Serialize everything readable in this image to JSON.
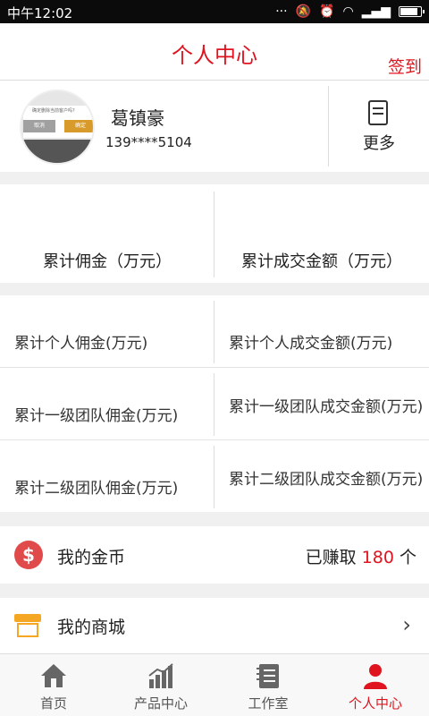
{
  "status_bar": {
    "time": "中午12:02"
  },
  "header": {
    "title": "个人中心",
    "sign_in": "签到"
  },
  "profile": {
    "name": "葛镇豪",
    "phone": "139****5104",
    "more": "更多",
    "avatar_dialog": {
      "text": "确定删除当前客户吗?",
      "cancel": "取消",
      "confirm": "确定"
    }
  },
  "summary": [
    {
      "label": "累计佣金（万元）"
    },
    {
      "label": "累计成交金额（万元）"
    }
  ],
  "stats": [
    {
      "left": "累计个人佣金(万元)",
      "right": "累计个人成交金额(万元)"
    },
    {
      "left": "累计一级团队佣金(万元)",
      "right": "累计一级团队成交金额(万元)"
    },
    {
      "left": "累计二级团队佣金(万元)",
      "right": "累计二级团队成交金额(万元)"
    }
  ],
  "coins": {
    "label": "我的金币",
    "prefix": "已赚取",
    "value": "180",
    "suffix": "个"
  },
  "mall": {
    "label": "我的商城"
  },
  "tabs": [
    {
      "label": "首页",
      "icon": "home-icon"
    },
    {
      "label": "产品中心",
      "icon": "chart-icon"
    },
    {
      "label": "工作室",
      "icon": "notebook-icon"
    },
    {
      "label": "个人中心",
      "icon": "user-icon"
    }
  ],
  "colors": {
    "accent": "#e0141e",
    "coin": "#e04a4a",
    "mall": "#f5a623"
  }
}
